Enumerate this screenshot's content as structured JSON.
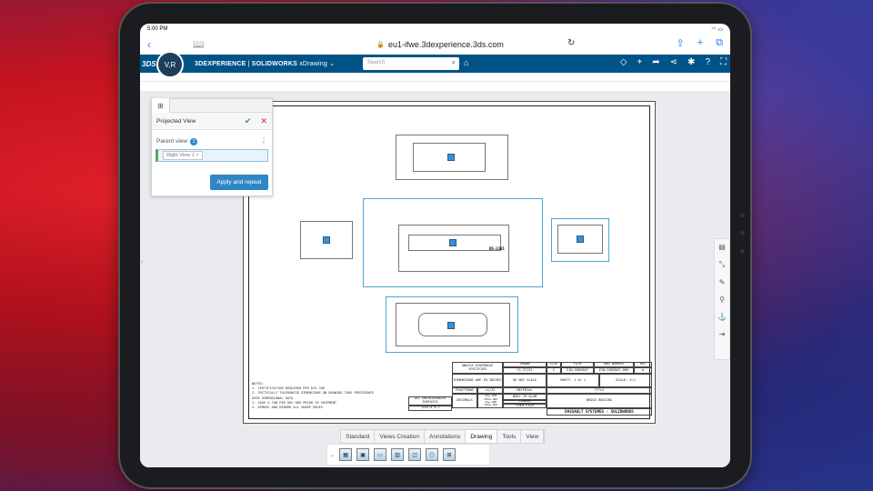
{
  "status": {
    "time": "5:00 PM",
    "wifi_icon": "wifi-icon"
  },
  "browser": {
    "url": "eu1-ifwe.3dexperience.3ds.com"
  },
  "app": {
    "brand": "3DEXPERIENCE",
    "product": "SOLIDWORKS",
    "app_name": "xDrawing",
    "compass_label": "V,R"
  },
  "search": {
    "placeholder": "Search"
  },
  "panel": {
    "title": "Projected View",
    "parent_label": "Parent view",
    "parent_count": "1",
    "chip_label": "Right View 1",
    "apply_label": "Apply and repeat"
  },
  "drawing": {
    "part_number": "DS-2301",
    "notes": [
      "NOTES:",
      "1. CERTIFICATION REQUIRED PER DIS-346",
      "2. CRITICALLY TOLERANCED DIMENSIONS ON DRAWING TAKE PRECEDENCE",
      "   OVER DIMENSIONAL DATA",
      "3. GAGE & TAB PER DDS-009 PRIOR TO SHIPMENT",
      "4. REMOVE AND DEBURR ALL SHARP EDGES"
    ],
    "title_block": {
      "unless": "UNLESS OTHERWISE SPECIFIED",
      "dims": "DIMENSIONS ARE IN INCHES",
      "fractions": "FRACTIONS",
      "fractions_val": "±1/32",
      "decimals": "DECIMALS",
      "decimals_val": ".Xx±.030  .XXX±.005  .Xx±.006  .XXX±.003",
      "drawn_label": "DRAWN",
      "drawn_val": "CS-ST131",
      "do_not_scale": "DO NOT SCALE",
      "material": "MATERIAL",
      "material_val": "BODY-70 ALUM",
      "finish": "FINISH",
      "finish_val": "CHEM FILM",
      "size": "SIZE",
      "size_val": "C",
      "fscm": "FSCM",
      "fscm_val": "EIN-56D5807",
      "dwg_no": "DWG NUMBER",
      "dwg_no_val": "EIN-56D5807-066",
      "rev": "REV",
      "rev_val": "A",
      "sheet": "SHEET: 1 of 1",
      "scale": "SCALE: 3:2",
      "title_label": "TITLE",
      "title_val": "WEDGE HOUSING",
      "company": "DASSAULT SYSTEMES - SOLIDWORKS",
      "surfaces": "ALL UNTOLERANCED SURFACES",
      "flat": ".010 A B C"
    }
  },
  "bottom_tabs": [
    "Standard",
    "Views Creation",
    "Annotations",
    "Drawing",
    "Tools",
    "View"
  ],
  "active_tab": "Drawing"
}
